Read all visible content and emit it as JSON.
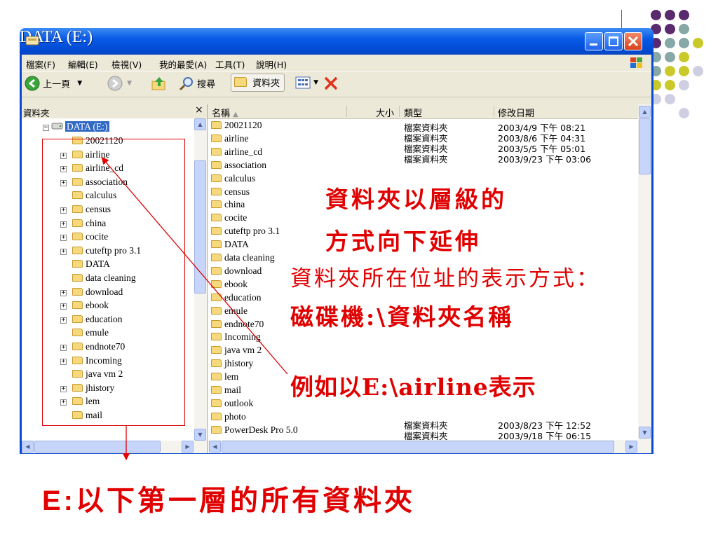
{
  "window": {
    "title": "DATA (E:)",
    "accent": "#0a49d6",
    "close_color": "#d9411a"
  },
  "menubar": [
    "檔案(F)",
    "編輯(E)",
    "檢視(V)",
    "我的最愛(A)",
    "工具(T)",
    "說明(H)"
  ],
  "toolbar": {
    "back_label": "上一頁",
    "search_label": "搜尋",
    "folders_label": "資料夾"
  },
  "folders_pane": {
    "header": "資料夾",
    "close_glyph": "×",
    "root": "DATA (E:)",
    "items": [
      "20021120",
      "airline",
      "airline_cd",
      "association",
      "calculus",
      "census",
      "china",
      "cocite",
      "cuteftp pro 3.1",
      "DATA",
      "data cleaning",
      "download",
      "ebook",
      "education",
      "emule",
      "endnote70",
      "Incoming",
      "java vm 2",
      "jhistory",
      "lem",
      "mail"
    ]
  },
  "list": {
    "columns": [
      "名稱",
      "大小",
      "類型",
      "修改日期"
    ],
    "rows": [
      "20021120",
      "airline",
      "airline_cd",
      "association",
      "calculus",
      "census",
      "china",
      "cocite",
      "cuteftp pro 3.1",
      "DATA",
      "data cleaning",
      "download",
      "ebook",
      "education",
      "emule",
      "endnote70",
      "Incoming",
      "java vm 2",
      "jhistory",
      "lem",
      "mail",
      "outlook",
      "photo",
      "PowerDesk Pro 5.0"
    ],
    "details": [
      {
        "type": "檔案資料夾",
        "date": "2003/4/9 下午 08:21"
      },
      {
        "type": "檔案資料夾",
        "date": "2003/8/6 下午 04:31"
      },
      {
        "type": "檔案資料夾",
        "date": "2003/5/5 下午 05:01"
      },
      {
        "type": "檔案資料夾",
        "date": "2003/9/23 下午 03:06"
      }
    ],
    "bottom_details": [
      {
        "type": "檔案資料夾",
        "date": "2003/8/23 下午 12:52"
      },
      {
        "type": "檔案資料夾",
        "date": "2003/9/18 下午 06:15"
      }
    ]
  },
  "annotations": {
    "line1": "資料夾以層級的",
    "line2": "方式向下延伸",
    "location_desc": "資料夾所在位址的表示方式：",
    "format": "磁碟機:\\資料夾名稱",
    "example": "例如以E:\\airline表示",
    "bottom": "E:以下第一層的所有資料夾",
    "color": "#e10000"
  },
  "decor_colors": {
    "purple": "#5a2a6e",
    "teal": "#86a8a6",
    "yellow": "#c9c92a",
    "lavender": "#cfcfe3"
  }
}
